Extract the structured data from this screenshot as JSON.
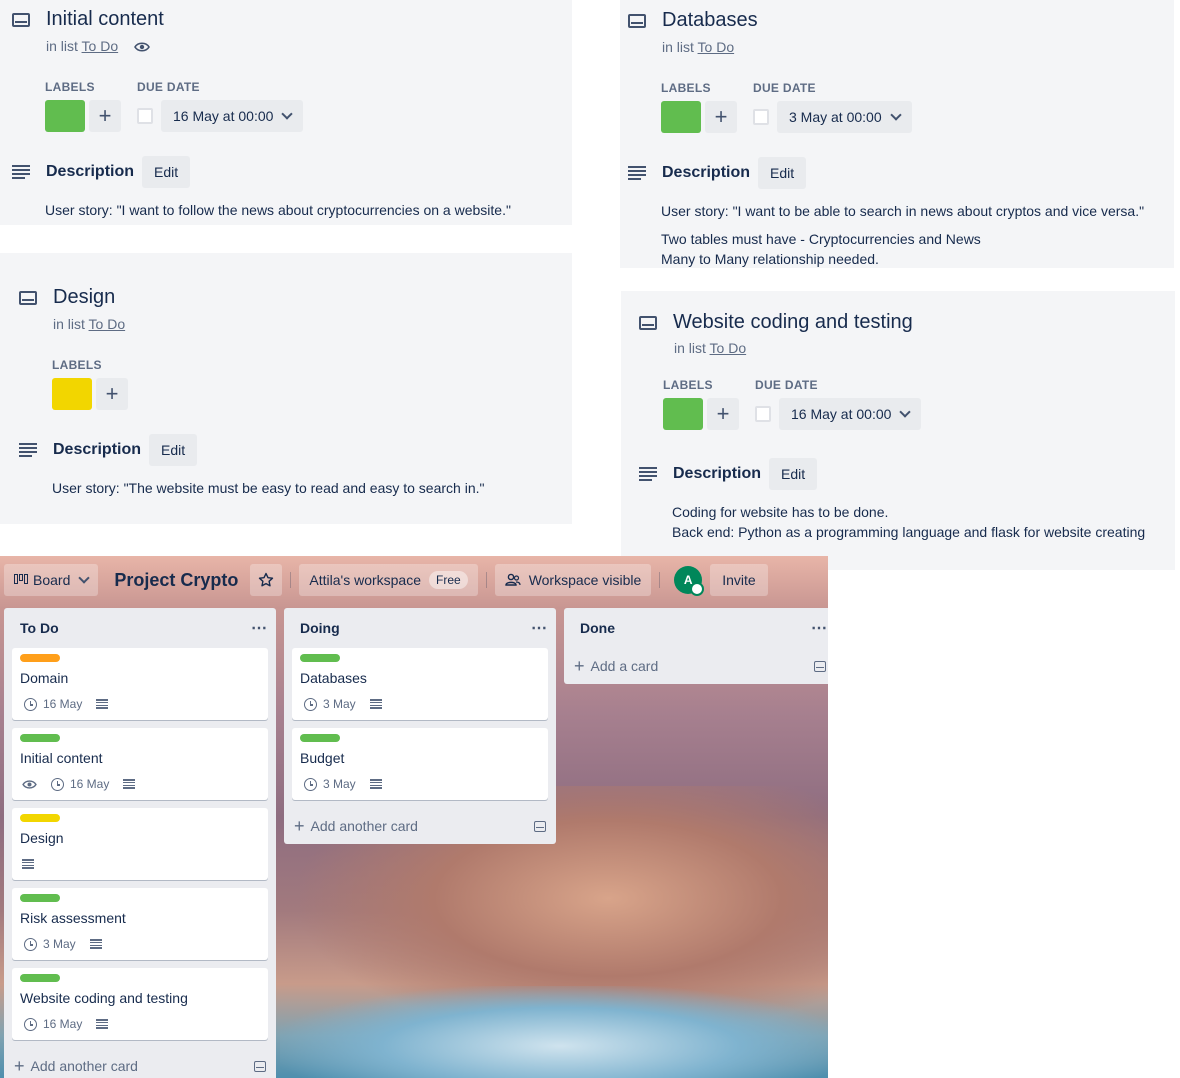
{
  "panels": {
    "initial_content": {
      "title": "Initial content",
      "in_list_prefix": "in list",
      "list_name": "To Do",
      "labels_heading": "LABELS",
      "due_heading": "DUE DATE",
      "due_value": "16 May at 00:00",
      "label_color": "#61bd4f",
      "description_heading": "Description",
      "edit_label": "Edit",
      "description": "User story: \"I want to follow the news about cryptocurrencies on a website.\""
    },
    "design": {
      "title": "Design",
      "in_list_prefix": "in list",
      "list_name": "To Do",
      "labels_heading": "LABELS",
      "label_color": "#f2d600",
      "description_heading": "Description",
      "edit_label": "Edit",
      "description": "User story: \"The website must be easy to read and easy to search in.\""
    },
    "databases": {
      "title": "Databases",
      "in_list_prefix": "in list",
      "list_name": "To Do",
      "labels_heading": "LABELS",
      "due_heading": "DUE DATE",
      "due_value": "3 May at 00:00",
      "label_color": "#61bd4f",
      "description_heading": "Description",
      "edit_label": "Edit",
      "description_lines": [
        "User story: \"I want to be able to search in news about cryptos and vice versa.\"",
        "Two tables must have - Cryptocurrencies and News",
        "Many to Many relationship needed."
      ]
    },
    "website": {
      "title": "Website coding and testing",
      "in_list_prefix": "in list",
      "list_name": "To Do",
      "labels_heading": "LABELS",
      "due_heading": "DUE DATE",
      "due_value": "16 May at 00:00",
      "label_color": "#61bd4f",
      "description_heading": "Description",
      "edit_label": "Edit",
      "description_lines": [
        "Coding for website has to be done.",
        "Back end: Python as a programming language and flask for website creating"
      ]
    }
  },
  "board": {
    "view_label": "Board",
    "title": "Project Crypto",
    "workspace": "Attila's workspace",
    "workspace_badge": "Free",
    "visibility": "Workspace visible",
    "avatar_initial": "A",
    "invite_label": "Invite",
    "lists": [
      {
        "name": "To Do",
        "add_label": "Add another card",
        "cards": [
          {
            "title": "Domain",
            "label_color": "#ff9f1a",
            "due": "16 May",
            "watch": false,
            "desc": true
          },
          {
            "title": "Initial content",
            "label_color": "#61bd4f",
            "due": "16 May",
            "watch": true,
            "desc": true
          },
          {
            "title": "Design",
            "label_color": "#f2d600",
            "due": "",
            "watch": false,
            "desc": true
          },
          {
            "title": "Risk assessment",
            "label_color": "#61bd4f",
            "due": "3 May",
            "watch": false,
            "desc": true
          },
          {
            "title": "Website coding and testing",
            "label_color": "#61bd4f",
            "due": "16 May",
            "watch": false,
            "desc": true
          }
        ]
      },
      {
        "name": "Doing",
        "add_label": "Add another card",
        "cards": [
          {
            "title": "Databases",
            "label_color": "#61bd4f",
            "due": "3 May",
            "watch": false,
            "desc": true
          },
          {
            "title": "Budget",
            "label_color": "#61bd4f",
            "due": "3 May",
            "watch": false,
            "desc": true
          }
        ]
      },
      {
        "name": "Done",
        "add_label": "Add a card",
        "cards": []
      }
    ]
  }
}
